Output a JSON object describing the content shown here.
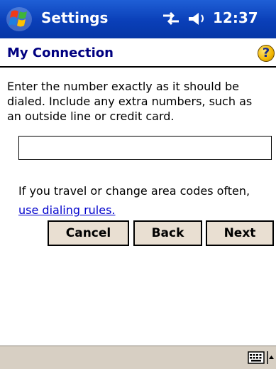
{
  "titlebar": {
    "app_title": "Settings",
    "time": "12:37"
  },
  "header": {
    "page_title": "My Connection",
    "help_label": "?"
  },
  "main": {
    "instructions": "Enter the number exactly as it should be dialed.  Include any extra numbers, such as an outside line or credit card.",
    "number_input_value": "",
    "travel_text": "If you travel or change area codes often,",
    "dialing_link": "use dialing rules."
  },
  "buttons": {
    "cancel": "Cancel",
    "back": "Back",
    "next": "Next"
  },
  "icons": {
    "start": "windows-flag-icon",
    "connectivity": "connectivity-arrows-icon",
    "volume": "speaker-icon",
    "help": "help-icon",
    "keyboard": "keyboard-icon",
    "sip": "up-arrow-icon"
  },
  "colors": {
    "titlebar": "#0a3fb8",
    "title_text": "#000080",
    "link": "#0000cc",
    "button_face": "#e9dfd2",
    "menubar": "#d7cfc3"
  }
}
